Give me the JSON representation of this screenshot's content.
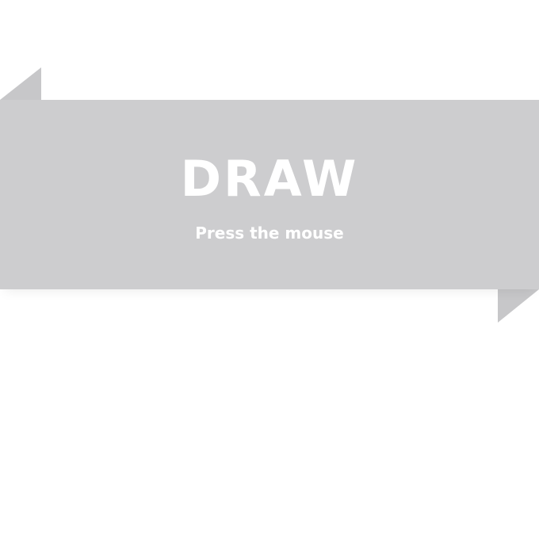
{
  "banner": {
    "title": "DRAW",
    "subtitle": "Press the mouse"
  },
  "colors": {
    "background": "#ffffff",
    "banner": "#cdcdcf",
    "fold": "#c7c7c9",
    "text": "#ffffff"
  }
}
